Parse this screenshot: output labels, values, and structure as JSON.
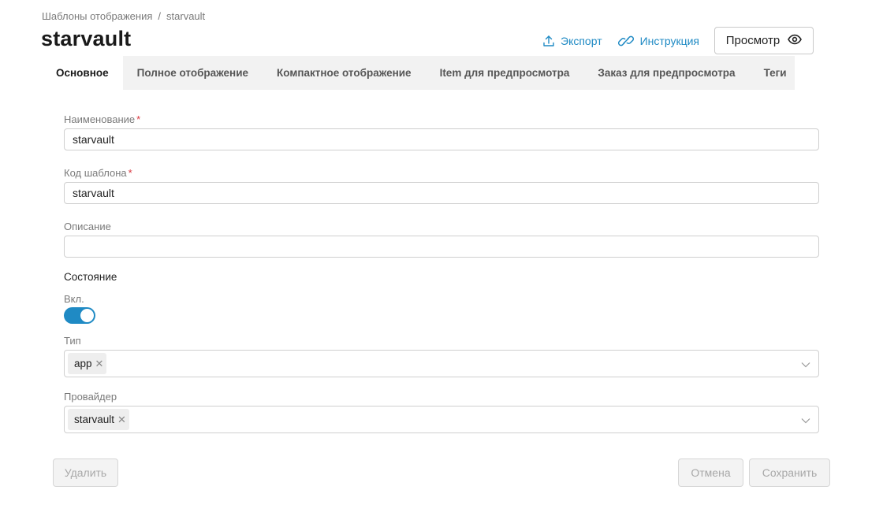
{
  "breadcrumb": {
    "parent": "Шаблоны отображения",
    "separator": "/",
    "current": "starvault"
  },
  "page_title": "starvault",
  "header_actions": {
    "export": "Экспорт",
    "instruction": "Инструкция",
    "preview": "Просмотр"
  },
  "tabs": [
    {
      "label": "Основное",
      "active": true
    },
    {
      "label": "Полное отображение",
      "active": false
    },
    {
      "label": "Компактное отображение",
      "active": false
    },
    {
      "label": "Item для предпросмотра",
      "active": false
    },
    {
      "label": "Заказ для предпросмотра",
      "active": false
    },
    {
      "label": "Теги",
      "active": false
    }
  ],
  "form": {
    "name": {
      "label": "Наименование",
      "required": "*",
      "value": "starvault"
    },
    "code": {
      "label": "Код шаблона",
      "required": "*",
      "value": "starvault"
    },
    "description": {
      "label": "Описание",
      "value": ""
    },
    "state": {
      "title": "Состояние",
      "toggle_label": "Вкл.",
      "enabled": true
    },
    "type": {
      "label": "Тип",
      "chips": [
        "app"
      ]
    },
    "provider": {
      "label": "Провайдер",
      "chips": [
        "starvault"
      ]
    }
  },
  "buttons": {
    "delete": "Удалить",
    "cancel": "Отмена",
    "save": "Сохранить"
  },
  "colors": {
    "accent": "#1f8ac4",
    "required": "#d9363e",
    "tab_bar": "#f2f2f2",
    "disabled_text": "#a8a8a8"
  },
  "icons": {
    "export": "upload-icon",
    "instruction": "link-icon",
    "preview": "eye-icon",
    "select": "chevron-down-icon",
    "chip_remove": "close-icon"
  }
}
